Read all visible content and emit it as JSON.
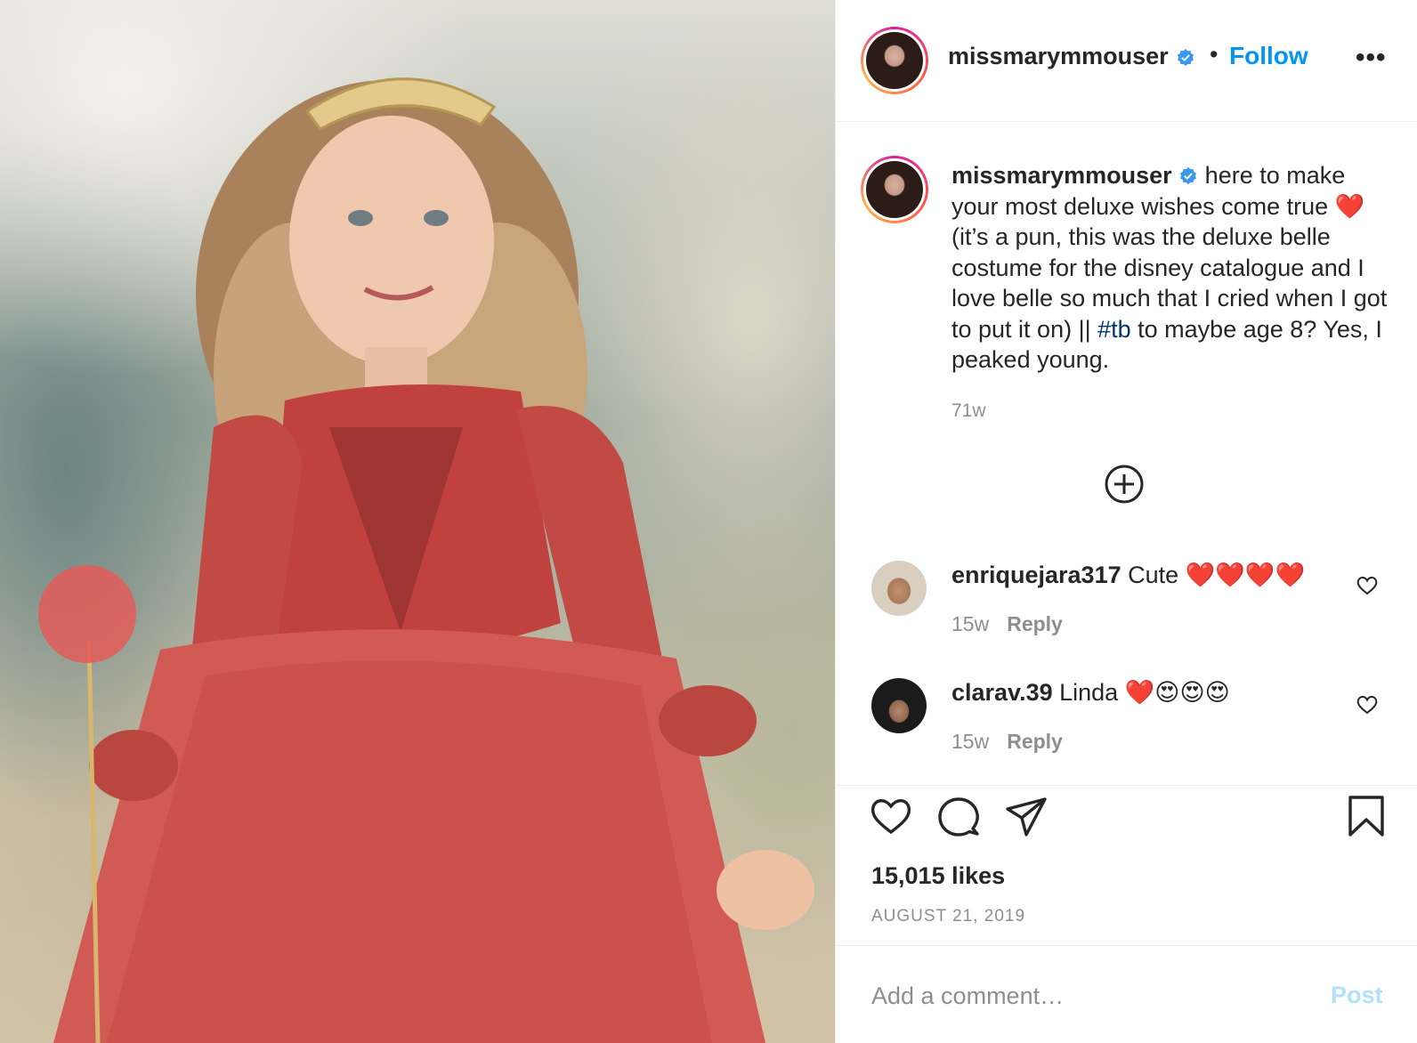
{
  "post": {
    "photo_icon": "photo-girl-in-red-dress",
    "header": {
      "username": "missmarymmouser",
      "separator": "•",
      "follow_label": "Follow",
      "more_icon": "more-options-icon",
      "more_label": "•••"
    },
    "caption": {
      "username": "missmarymmouser",
      "text_before_tag": "here to make your most deluxe wishes come true ❤️ (it’s a pun, this was the deluxe belle costume for the disney catalogue and I love belle so much that I cried when I got to put it on) || ",
      "hashtag": "#tb",
      "text_after_tag": " to maybe age 8? Yes, I peaked young.",
      "time": "71w"
    },
    "load_more_icon": "plus-circle-icon",
    "comments": [
      {
        "username": "enriquejara317",
        "text": "Cute ❤️❤️❤️❤️",
        "time": "15w",
        "reply_label": "Reply"
      },
      {
        "username": "clarav.39",
        "text": "Linda ❤️😍😍😍",
        "time": "15w",
        "reply_label": "Reply"
      }
    ],
    "likes": "15,015 likes",
    "date": "AUGUST 21, 2019",
    "add_comment": {
      "placeholder": "Add a comment…",
      "post_label": "Post"
    }
  },
  "colors": {
    "accent": "#0095f6",
    "text": "#262626",
    "muted": "#8e8e8e",
    "post_disabled": "#b2dffc",
    "hashtag": "#00376b"
  }
}
